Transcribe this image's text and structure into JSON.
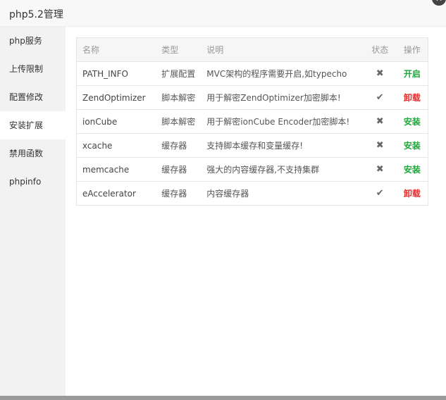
{
  "window": {
    "title": "php5.2管理",
    "close_icon": "close-icon"
  },
  "sidebar": {
    "items": [
      {
        "label": "php服务"
      },
      {
        "label": "上传限制"
      },
      {
        "label": "配置修改"
      },
      {
        "label": "安装扩展"
      },
      {
        "label": "禁用函数"
      },
      {
        "label": "phpinfo"
      }
    ],
    "active_index": 3
  },
  "table": {
    "headers": [
      "名称",
      "类型",
      "说明",
      "状态",
      "操作"
    ],
    "rows": [
      {
        "name": "PATH_INFO",
        "type": "扩展配置",
        "desc": "MVC架构的程序需要开启,如typecho",
        "status_icon": "cross-icon",
        "status": "✖",
        "op": "开启",
        "op_color": "#20a53a"
      },
      {
        "name": "ZendOptimizer",
        "type": "脚本解密",
        "desc": "用于解密ZendOptimizer加密脚本!",
        "status_icon": "check-icon",
        "status": "✔",
        "op": "卸载",
        "op_color": "#e62d2d"
      },
      {
        "name": "ionCube",
        "type": "脚本解密",
        "desc": "用于解密ionCube Encoder加密脚本!",
        "status_icon": "cross-icon",
        "status": "✖",
        "op": "安装",
        "op_color": "#20a53a"
      },
      {
        "name": "xcache",
        "type": "缓存器",
        "desc": "支持脚本缓存和变量缓存!",
        "status_icon": "cross-icon",
        "status": "✖",
        "op": "安装",
        "op_color": "#20a53a"
      },
      {
        "name": "memcache",
        "type": "缓存器",
        "desc": "强大的内容缓存器,不支持集群",
        "status_icon": "cross-icon",
        "status": "✖",
        "op": "安装",
        "op_color": "#20a53a"
      },
      {
        "name": "eAccelerator",
        "type": "缓存器",
        "desc": "内容缓存器",
        "status_icon": "check-icon",
        "status": "✔",
        "op": "卸载",
        "op_color": "#e62d2d"
      }
    ]
  }
}
